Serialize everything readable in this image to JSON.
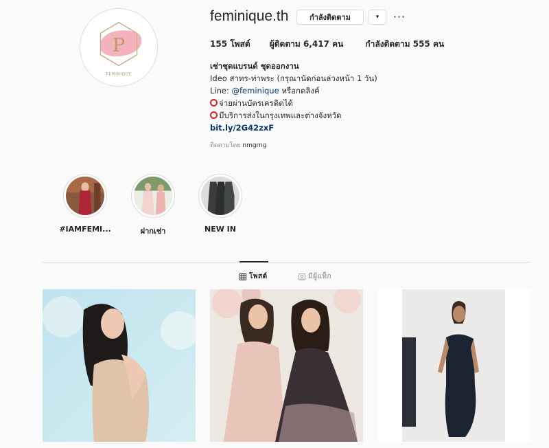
{
  "profile": {
    "username": "feminique.th",
    "following_button": "กำลังติดตาม",
    "caret": "▾",
    "more": "···",
    "avatar_text": "FEMINIQUE",
    "avatar_letter": "P"
  },
  "stats": {
    "posts": "155 โพสต์",
    "followers": "ผู้ติดตาม 6,417 คน",
    "following": "กำลังติดตาม 555 คน"
  },
  "bio": {
    "name": "เช่าชุดแบรนด์ ชุดออกงาน",
    "line1": "Ideo สาทร-ท่าพระ (กรุณานัดก่อนล่วงหน้า 1 วัน)",
    "line2_prefix": "Line: ",
    "line2_mention": "@feminique",
    "line2_suffix": " หรือกดลิงค์",
    "line3": "จ่ายผ่านบัตรเครดิตได้",
    "line4": "มีบริการส่งในกรุงเทพและต่างจังหวัด",
    "link": "bit.ly/2G42zxF",
    "followed_by_prefix": "ติดตามโดย",
    "followed_by_name": "nmgrng"
  },
  "highlights": [
    {
      "label": "#IAMFEMI..."
    },
    {
      "label": "ฝากเช่า"
    },
    {
      "label": "NEW IN"
    }
  ],
  "tabs": {
    "posts": "โพสต์",
    "tagged": "มีผู้แท็ก"
  },
  "colors": {
    "link": "#00376b",
    "secondary_text": "#8e8e8e",
    "border": "#dbdbdb",
    "emoji_ring": "#d0262b"
  }
}
